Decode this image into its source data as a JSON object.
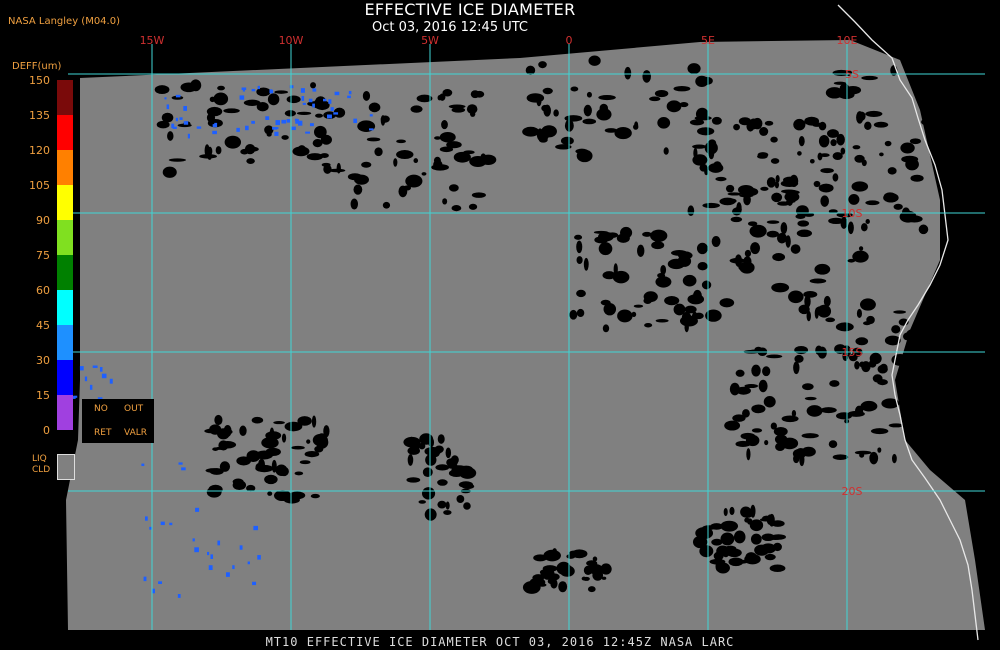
{
  "header": {
    "title": "EFFECTIVE ICE DIAMETER",
    "subtitle": "Oct 03, 2016 12:45 UTC",
    "credit": "NASA Langley (M04.0)"
  },
  "map": {
    "lon_labels": [
      "15W",
      "10W",
      "5W",
      "0",
      "5E",
      "10E"
    ],
    "lat_labels": [
      "5S",
      "10S",
      "15S",
      "20S"
    ],
    "grid_color": "#3fd6d6",
    "label_color": "#d03030",
    "cloud_color": "#808080"
  },
  "legend": {
    "title": "DEFF(um)",
    "ticks": [
      "150",
      "135",
      "120",
      "105",
      "90",
      "75",
      "60",
      "45",
      "30",
      "15",
      "0"
    ],
    "colors": [
      "#7a0a0a",
      "#ff0000",
      "#ff8000",
      "#ffff00",
      "#80e020",
      "#008000",
      "#00ffff",
      "#1e90ff",
      "#0000ff",
      "#a040e0"
    ],
    "no_ret_1": "NO",
    "no_ret_2": "RET",
    "out_valr_1": "OUT",
    "out_valr_2": "VALR",
    "liq_1": "LIQ",
    "liq_2": "CLD"
  },
  "footer": "MT10  EFFECTIVE ICE DIAMETER   OCT 03, 2016 12:45Z   NASA LARC"
}
